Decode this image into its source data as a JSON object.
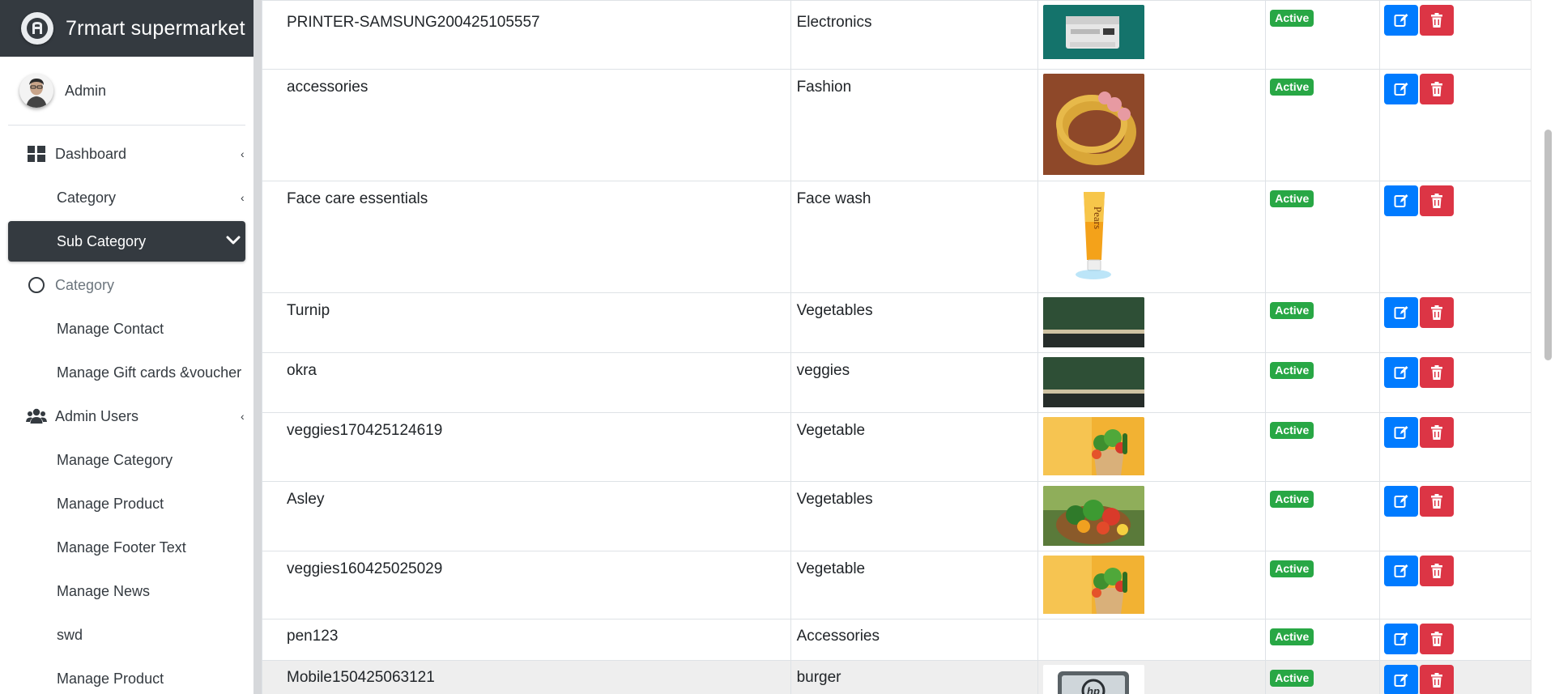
{
  "brand": {
    "name": "7rmart supermarket",
    "icon": "brand-logo-icon"
  },
  "user": {
    "name": "Admin",
    "icon": "user-avatar"
  },
  "nav": [
    {
      "label": "Dashboard",
      "icon": "dashboard-grid-icon",
      "type": "top",
      "caret": true
    },
    {
      "label": "Category",
      "type": "sub",
      "caret": true
    },
    {
      "label": "Sub Category",
      "type": "active",
      "chevron": true
    },
    {
      "label": "Category",
      "icon": "circle-icon",
      "type": "muted"
    },
    {
      "label": "Manage Contact",
      "type": "sub"
    },
    {
      "label": "Manage Gift cards &voucher",
      "type": "sub"
    },
    {
      "label": "Admin Users",
      "icon": "users-icon",
      "type": "top",
      "caret": true
    },
    {
      "label": "Manage Category",
      "type": "sub"
    },
    {
      "label": "Manage Product",
      "type": "sub"
    },
    {
      "label": "Manage Footer Text",
      "type": "sub"
    },
    {
      "label": "Manage News",
      "type": "sub"
    },
    {
      "label": "swd",
      "type": "sub"
    },
    {
      "label": "Manage Product",
      "type": "sub"
    }
  ],
  "table": {
    "rows": [
      {
        "name": "PRINTER-SAMSUNG200425105557",
        "category": "Electronics",
        "image": "printer",
        "status": "Active"
      },
      {
        "name": "accessories",
        "category": "Fashion",
        "image": "bangles",
        "status": "Active"
      },
      {
        "name": "Face care essentials",
        "category": "Face wash",
        "image": "facewash",
        "status": "Active"
      },
      {
        "name": "Turnip",
        "category": "Vegetables",
        "image": "board",
        "status": "Active"
      },
      {
        "name": "okra",
        "category": "veggies",
        "image": "board",
        "status": "Active"
      },
      {
        "name": "veggies170425124619",
        "category": "Vegetable",
        "image": "veggiebag",
        "status": "Active"
      },
      {
        "name": "Asley",
        "category": "Vegetables",
        "image": "basket",
        "status": "Active"
      },
      {
        "name": "veggies160425025029",
        "category": "Vegetable",
        "image": "veggiebag",
        "status": "Active"
      },
      {
        "name": "pen123",
        "category": "Accessories",
        "image": "none",
        "status": "Active"
      },
      {
        "name": "Mobile150425063121",
        "category": "burger",
        "image": "laptop",
        "status": "Active"
      }
    ],
    "actions": {
      "edit_icon": "edit-icon",
      "delete_icon": "trash-icon"
    }
  },
  "colors": {
    "sidebar_dark": "#343a40",
    "badge_green": "#28a745",
    "edit_blue": "#007bff",
    "delete_red": "#dc3545"
  }
}
